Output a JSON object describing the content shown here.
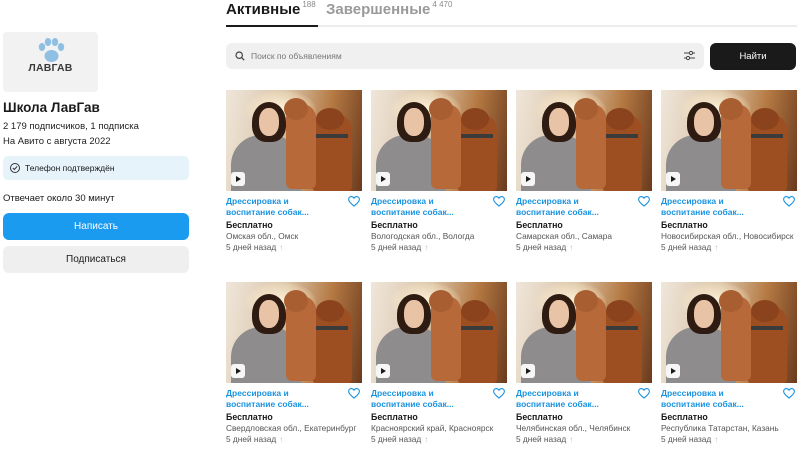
{
  "profile": {
    "logo_text": "ЛАВГАВ",
    "name": "Школа ЛавГав",
    "followers": "2 179 подписчиков, 1 подписка",
    "since": "На Авито с августа 2022",
    "verified": "Телефон подтверждён",
    "reply_time": "Отвечает около 30 минут",
    "write_button": "Написать",
    "subscribe_button": "Подписаться"
  },
  "tabs": [
    {
      "label": "Активные",
      "count": "188",
      "active": true
    },
    {
      "label": "Завершенные",
      "count": "4 470",
      "active": false
    }
  ],
  "search": {
    "placeholder": "Поиск по объявлениям",
    "button": "Найти"
  },
  "listings": [
    {
      "title": "Дрессировка и воспитание собак...",
      "price": "Бесплатно",
      "location": "Омская обл., Омск",
      "date": "5 дней назад"
    },
    {
      "title": "Дрессировка и воспитание собак...",
      "price": "Бесплатно",
      "location": "Вологодская обл., Вологда",
      "date": "5 дней назад"
    },
    {
      "title": "Дрессировка и воспитание собак...",
      "price": "Бесплатно",
      "location": "Самарская обл., Самара",
      "date": "5 дней назад"
    },
    {
      "title": "Дрессировка и воспитание собак...",
      "price": "Бесплатно",
      "location": "Новосибирская обл., Новосибирск",
      "date": "5 дней назад"
    },
    {
      "title": "Дрессировка и воспитание собак...",
      "price": "Бесплатно",
      "location": "Свердловская обл., Екатеринбург",
      "date": "5 дней назад"
    },
    {
      "title": "Дрессировка и воспитание собак...",
      "price": "Бесплатно",
      "location": "Красноярский край, Красноярск",
      "date": "5 дней назад"
    },
    {
      "title": "Дрессировка и воспитание собак...",
      "price": "Бесплатно",
      "location": "Челябинская обл., Челябинск",
      "date": "5 дней назад"
    },
    {
      "title": "Дрессировка и воспитание собак...",
      "price": "Бесплатно",
      "location": "Республика Татарстан, Казань",
      "date": "5 дней назад"
    }
  ],
  "colors": {
    "accent": "#1a9bf0",
    "link": "#1a93e0",
    "dark_button": "#1a1a1a",
    "verified_bg": "#e7f3fb"
  },
  "icons": {
    "search": "search-icon",
    "filter": "filter-icon",
    "favorite": "heart-icon",
    "video": "play-icon",
    "verified": "check-circle-icon",
    "raised": "arrow-up-icon"
  }
}
